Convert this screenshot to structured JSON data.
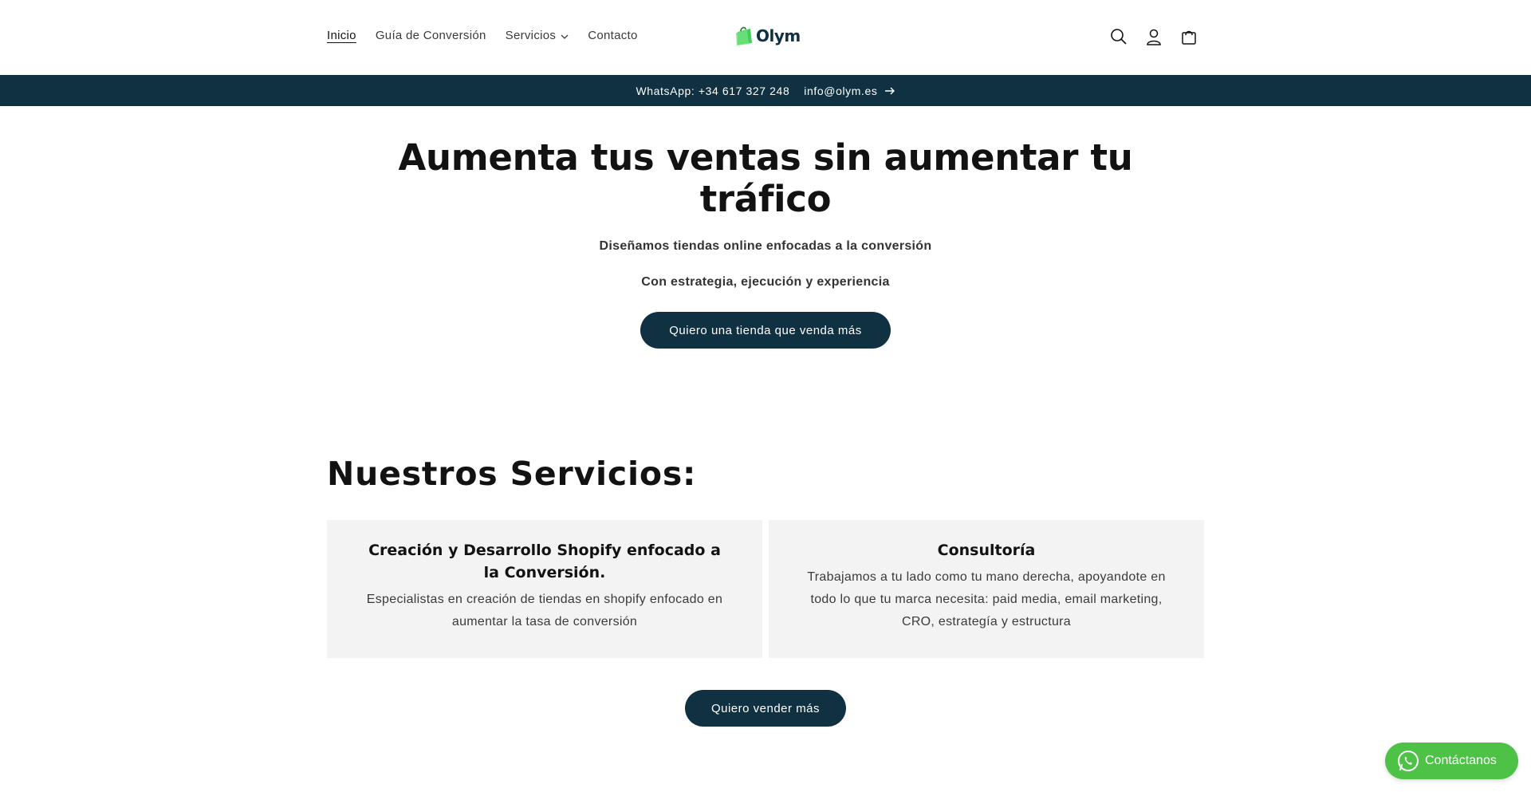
{
  "nav": {
    "items": [
      {
        "label": "Inicio",
        "active": true
      },
      {
        "label": "Guía de Conversión",
        "active": false
      },
      {
        "label": "Servicios",
        "active": false,
        "dropdown": true
      },
      {
        "label": "Contacto",
        "active": false
      }
    ]
  },
  "logo": {
    "text": "Olym",
    "icon": "shopping-bag-logo-icon"
  },
  "header_icons": [
    "search-icon",
    "account-icon",
    "cart-icon"
  ],
  "announcement": {
    "text": "WhatsApp: +34 617 327 248    info@olym.es",
    "icon": "arrow-right-icon"
  },
  "hero": {
    "title": "Aumenta tus ventas sin aumentar tu tráfico",
    "subtitle_1": "Diseñamos tiendas online enfocadas a la conversión",
    "subtitle_2": "Con estrategia, ejecución y experiencia",
    "button": "Quiero una tienda que venda más"
  },
  "services": {
    "title": "Nuestros Servicios:",
    "cards": [
      {
        "title": "Creación y Desarrollo Shopify enfocado a la Conversión.",
        "text": "Especialistas en creación de tiendas en shopify enfocado en aumentar la tasa de conversión"
      },
      {
        "title": "Consultoría",
        "text": "Trabajamos a tu lado como tu mano derecha, apoyandote en todo lo que tu marca necesita: paid media, email marketing, CRO, estrategía y estructura"
      }
    ],
    "button": "Quiero vender más"
  },
  "whatsapp": {
    "label": "Contáctanos",
    "icon": "whatsapp-icon"
  },
  "colors": {
    "brand": "#0f3142",
    "whatsapp": "#4dc247",
    "card_bg": "#f3f3f3",
    "logo_green": "#3fcf5a"
  }
}
